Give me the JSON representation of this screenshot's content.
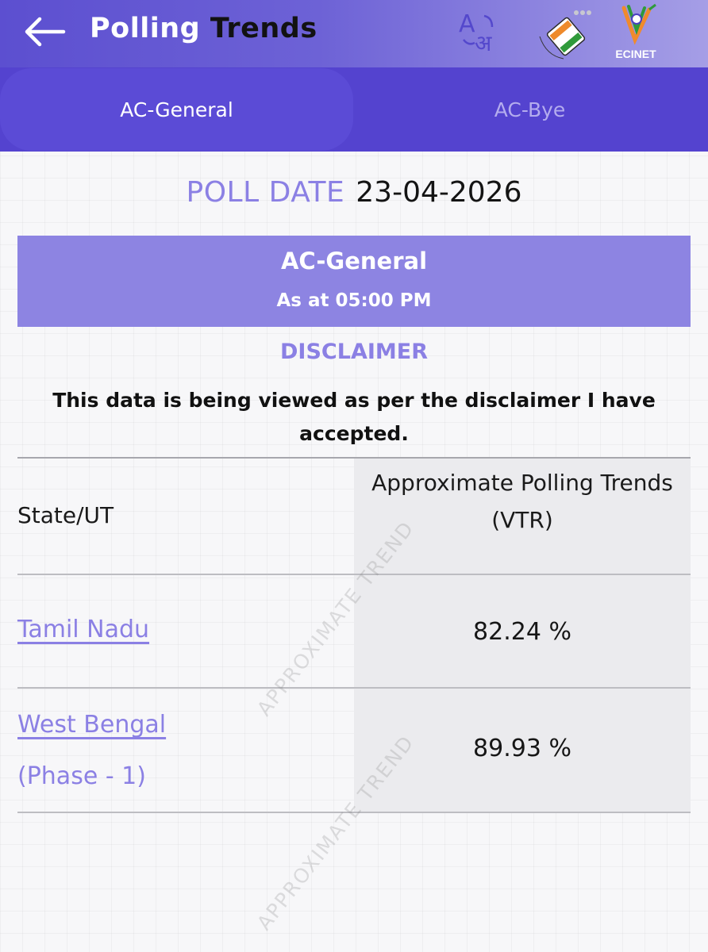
{
  "header": {
    "title_part1": "Polling",
    "title_part2": " Trends",
    "ecinet_label": "ECINET"
  },
  "tabs": [
    {
      "label": "AC-General",
      "active": true
    },
    {
      "label": "AC-Bye",
      "active": false
    }
  ],
  "poll": {
    "date_label": "POLL DATE",
    "date_value": "23-04-2026"
  },
  "banner": {
    "title": "AC-General",
    "subtitle": "As at 05:00 PM"
  },
  "disclaimer": {
    "heading": "DISCLAIMER",
    "text": "This data is being viewed as per the disclaimer I have accepted."
  },
  "table": {
    "headers": [
      "State/UT",
      "Approximate Polling Trends (VTR)"
    ],
    "rows": [
      {
        "state": "Tamil Nadu",
        "sub": "",
        "vtr": "82.24 %"
      },
      {
        "state": "West Bengal",
        "sub": "(Phase - 1)",
        "vtr": "89.93 %"
      }
    ]
  },
  "watermark": "APPROXIMATE TREND",
  "colors": {
    "appbar_start": "#5c4fd0",
    "accent_lavender": "#8b80e4",
    "tabbar": "#5443cf",
    "banner": "#8d84e2"
  }
}
